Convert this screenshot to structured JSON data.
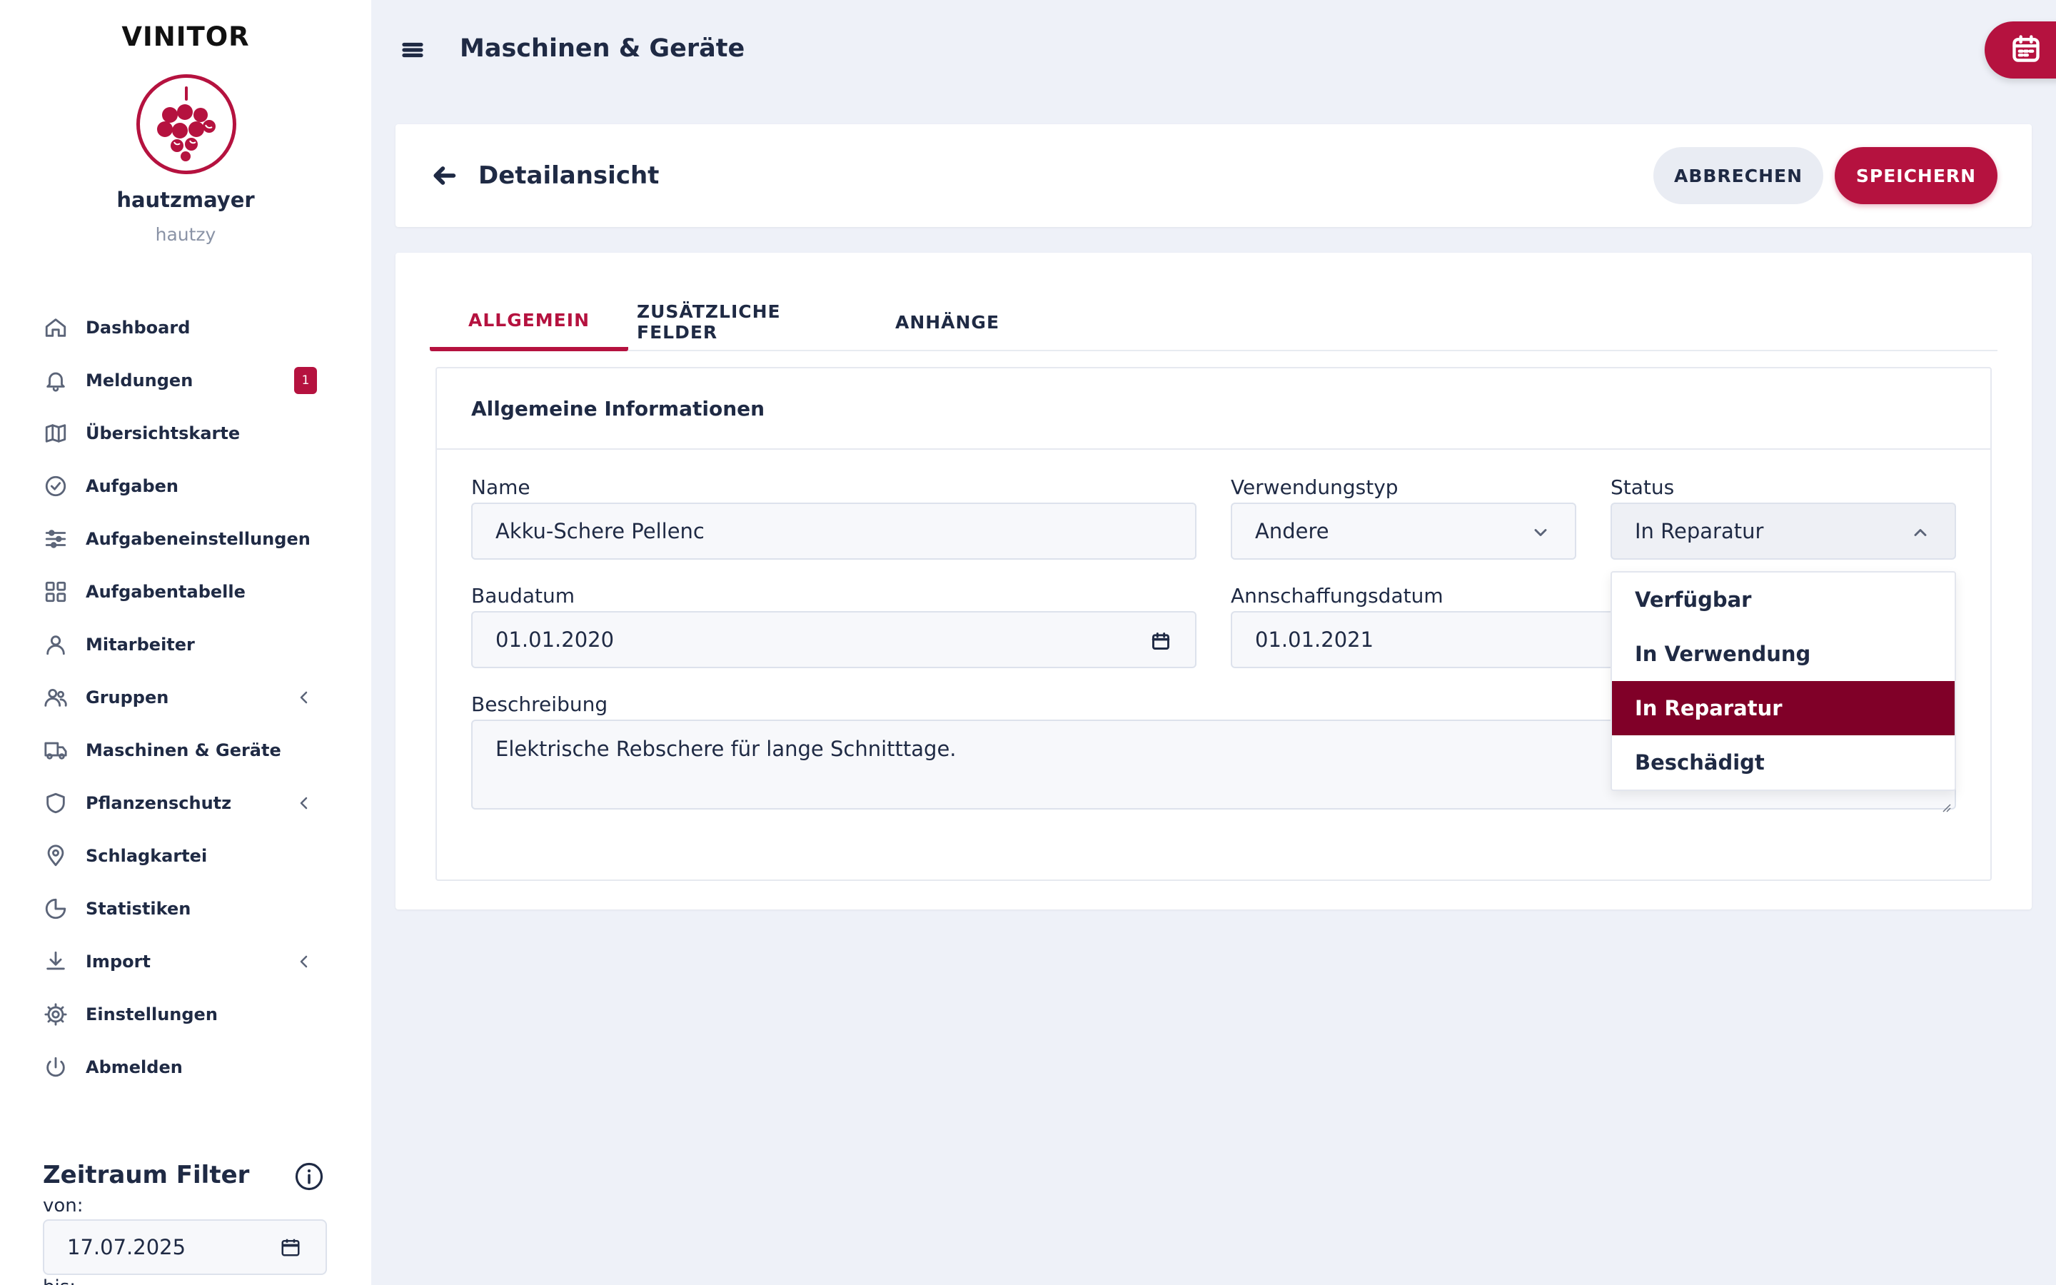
{
  "sidebar": {
    "brand": "VINITOR",
    "user_name": "hautzmayer",
    "user_handle": "hautzy",
    "items": [
      {
        "label": "Dashboard"
      },
      {
        "label": "Meldungen",
        "badge": "1"
      },
      {
        "label": "Übersichtskarte"
      },
      {
        "label": "Aufgaben"
      },
      {
        "label": "Aufgabeneinstellungen"
      },
      {
        "label": "Aufgabentabelle"
      },
      {
        "label": "Mitarbeiter"
      },
      {
        "label": "Gruppen"
      },
      {
        "label": "Maschinen & Geräte"
      },
      {
        "label": "Pflanzenschutz"
      },
      {
        "label": "Schlagkartei"
      },
      {
        "label": "Statistiken"
      },
      {
        "label": "Import"
      },
      {
        "label": "Einstellungen"
      },
      {
        "label": "Abmelden"
      }
    ],
    "filter": {
      "title": "Zeitraum Filter",
      "from_label": "von:",
      "from_value": "17.07.2025",
      "to_label": "bis:"
    }
  },
  "header": {
    "title": "Maschinen & Geräte"
  },
  "detail": {
    "title": "Detailansicht",
    "cancel_label": "ABBRECHEN",
    "save_label": "SPEICHERN"
  },
  "tabs": [
    {
      "label": "ALLGEMEIN",
      "active": true
    },
    {
      "label": "ZUSÄTZLICHE FELDER"
    },
    {
      "label": "ANHÄNGE"
    }
  ],
  "form": {
    "section_title": "Allgemeine Informationen",
    "name": {
      "label": "Name",
      "value": "Akku-Schere Pellenc"
    },
    "usage_type": {
      "label": "Verwendungstyp",
      "value": "Andere"
    },
    "status": {
      "label": "Status",
      "value": "In Reparatur",
      "options": [
        "Verfügbar",
        "In Verwendung",
        "In Reparatur",
        "Beschädigt"
      ]
    },
    "build_date": {
      "label": "Baudatum",
      "value": "01.01.2020"
    },
    "purchase_date": {
      "label": "Annschaffungsdatum",
      "value": "01.01.2021"
    },
    "description": {
      "label": "Beschreibung",
      "value": "Elektrische Rebschere für lange Schnitttage."
    }
  },
  "colors": {
    "accent": "#b5123f",
    "selected": "#800028",
    "background": "#eef1f8"
  }
}
